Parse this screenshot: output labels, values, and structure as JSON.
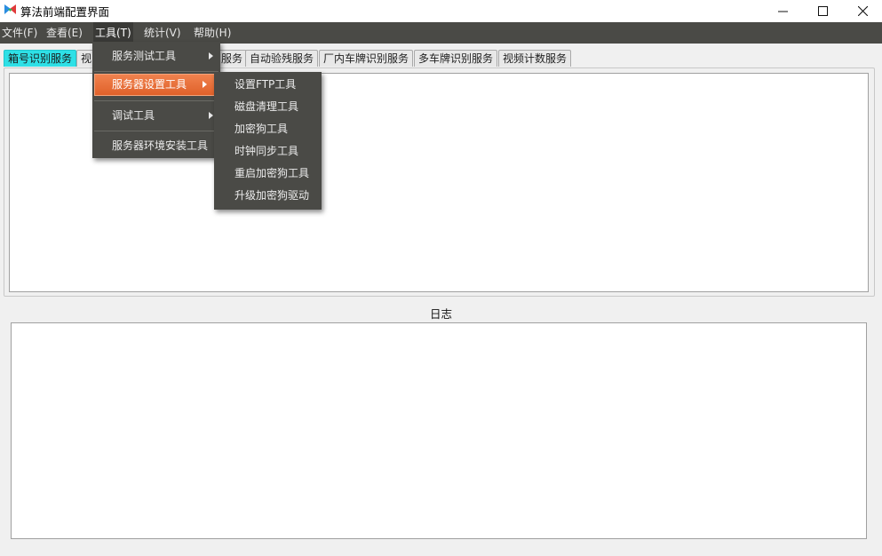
{
  "window": {
    "title": "算法前端配置界面"
  },
  "menubar": {
    "items": [
      {
        "label": "文件(F)"
      },
      {
        "label": "查看(E)"
      },
      {
        "label": "工具(T)"
      },
      {
        "label": "统计(V)"
      },
      {
        "label": "帮助(H)"
      }
    ]
  },
  "tabs": [
    {
      "label": "箱号识别服务"
    },
    {
      "label": "视"
    },
    {
      "label": "服务"
    },
    {
      "label": "自动验残服务"
    },
    {
      "label": "厂内车牌识别服务"
    },
    {
      "label": "多车牌识别服务"
    },
    {
      "label": "视频计数服务"
    }
  ],
  "tools_menu": {
    "items": [
      {
        "label": "服务测试工具"
      },
      {
        "label": "服务器设置工具"
      },
      {
        "label": "调试工具"
      },
      {
        "label": "服务器环境安装工具"
      }
    ]
  },
  "server_settings_submenu": {
    "items": [
      {
        "label": "设置FTP工具"
      },
      {
        "label": "磁盘清理工具"
      },
      {
        "label": "加密狗工具"
      },
      {
        "label": "时钟同步工具"
      },
      {
        "label": "重启加密狗工具"
      },
      {
        "label": "升级加密狗驱动"
      }
    ]
  },
  "log": {
    "label": "日志"
  },
  "colors": {
    "menubar": "#4a4a46",
    "selected_tab": "#2ee0e6",
    "highlight": "#e8703a"
  }
}
